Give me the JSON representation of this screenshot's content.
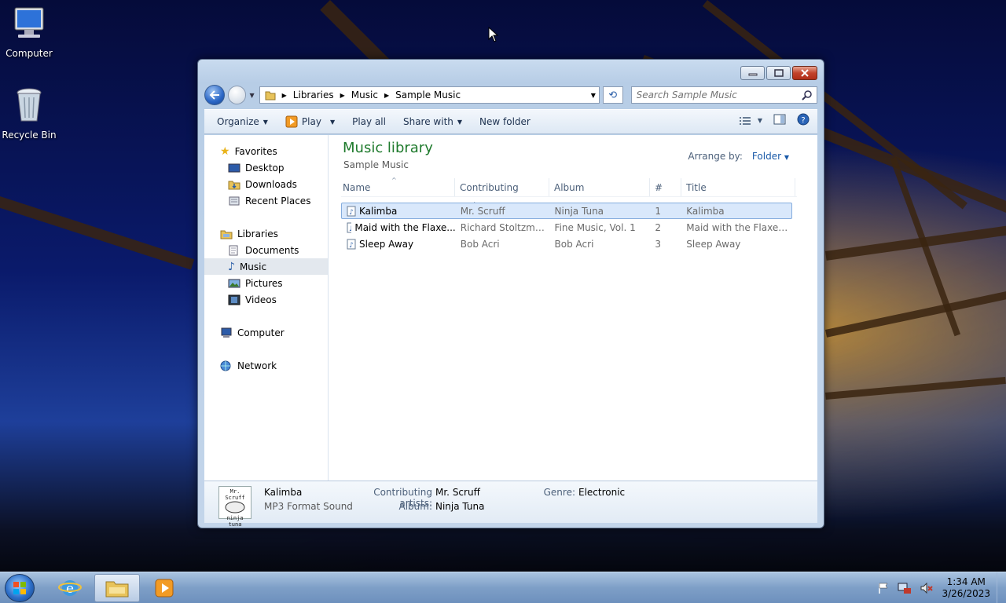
{
  "desktop": {
    "icons": [
      {
        "label": "Computer"
      },
      {
        "label": "Recycle Bin"
      }
    ]
  },
  "window": {
    "address": {
      "crumbs": [
        "Libraries",
        "Music",
        "Sample Music"
      ]
    },
    "search": {
      "placeholder": "Search Sample Music"
    },
    "toolbar": {
      "organize": "Organize",
      "play": "Play",
      "play_all": "Play all",
      "share_with": "Share with",
      "new_folder": "New folder"
    },
    "nav": {
      "favorites": "Favorites",
      "desktop": "Desktop",
      "downloads": "Downloads",
      "recent_places": "Recent Places",
      "libraries": "Libraries",
      "documents": "Documents",
      "music": "Music",
      "pictures": "Pictures",
      "videos": "Videos",
      "computer": "Computer",
      "network": "Network"
    },
    "library": {
      "title": "Music library",
      "subtitle": "Sample Music",
      "arrange_label": "Arrange by:",
      "arrange_value": "Folder"
    },
    "columns": [
      "Name",
      "Contributing artists",
      "Album",
      "#",
      "Title"
    ],
    "rows": [
      {
        "name": "Kalimba",
        "artist": "Mr. Scruff",
        "album": "Ninja Tuna",
        "num": "1",
        "title": "Kalimba"
      },
      {
        "name": "Maid with the Flaxe...",
        "artist": "Richard Stoltzman...",
        "album": "Fine Music, Vol. 1",
        "num": "2",
        "title": "Maid with the Flaxen H..."
      },
      {
        "name": "Sleep Away",
        "artist": "Bob Acri",
        "album": "Bob Acri",
        "num": "3",
        "title": "Sleep Away"
      }
    ],
    "details": {
      "thumb_text_top": "Mr. Scruff",
      "thumb_text_bottom": "ninja tuna",
      "name": "Kalimba",
      "type": "MP3 Format Sound",
      "artist_label": "Contributing artists:",
      "artist": "Mr. Scruff",
      "album_label": "Album:",
      "album": "Ninja Tuna",
      "genre_label": "Genre:",
      "genre": "Electronic"
    }
  },
  "taskbar": {
    "time": "1:34 AM",
    "date": "3/26/2023"
  },
  "colors": {
    "library_title": "#1e7a2c",
    "selection": "#d9e8fb",
    "link": "#1a5aa8"
  }
}
